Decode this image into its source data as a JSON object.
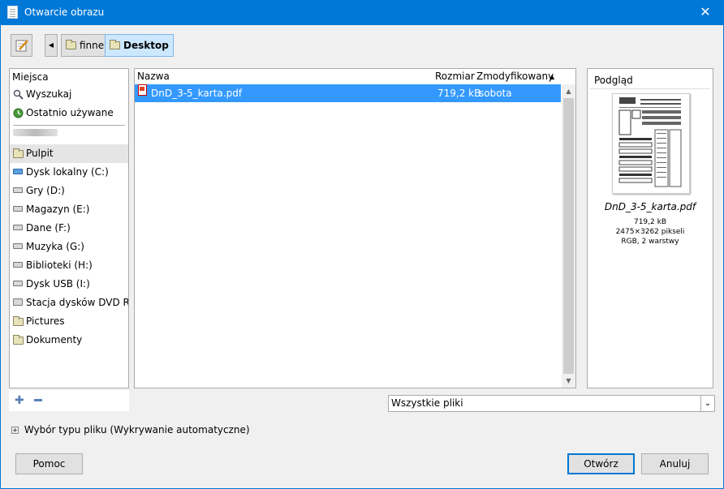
{
  "window": {
    "title": "Otwarcie obrazu",
    "close_glyph": "✕"
  },
  "toolbar": {
    "edit_icon": "pencil-icon",
    "back_glyph": "◀",
    "breadcrumbs": [
      {
        "label": "finne"
      },
      {
        "label": "Desktop"
      }
    ]
  },
  "places": {
    "header": "Miejsca",
    "items": [
      {
        "label": "Wyszukaj",
        "icon": "search-icon"
      },
      {
        "label": "Ostatnio używane",
        "icon": "recent-icon"
      },
      {
        "label": "Pulpit",
        "icon": "folder-icon"
      },
      {
        "label": "Dysk lokalny (C:)",
        "icon": "system-drive-icon"
      },
      {
        "label": "Gry (D:)",
        "icon": "drive-icon"
      },
      {
        "label": "Magazyn (E:)",
        "icon": "drive-icon"
      },
      {
        "label": "Dane (F:)",
        "icon": "drive-icon"
      },
      {
        "label": "Muzyka (G:)",
        "icon": "drive-icon"
      },
      {
        "label": "Biblioteki (H:)",
        "icon": "drive-icon"
      },
      {
        "label": "Dysk USB (I:)",
        "icon": "drive-icon"
      },
      {
        "label": "Stacja dysków DVD R...",
        "icon": "dvd-drive-icon"
      },
      {
        "label": "Pictures",
        "icon": "folder-icon"
      },
      {
        "label": "Dokumenty",
        "icon": "folder-icon"
      }
    ],
    "add_glyph": "✚"
  },
  "files": {
    "columns": {
      "name": "Nazwa",
      "size": "Rozmiar",
      "modified": "Zmodyfikowany",
      "sort_glyph": "▲"
    },
    "rows": [
      {
        "name": "DnD_3-5_karta.pdf",
        "size": "719,2 kB",
        "modified": "sobota"
      }
    ],
    "scroll_up": "▲",
    "scroll_down": "▼"
  },
  "preview": {
    "header": "Podgląd",
    "file_name": "DnD_3-5_karta.pdf",
    "size": "719,2 kB",
    "dimensions": "2475×3262 pikseli",
    "mode": "RGB, 2 warstwy"
  },
  "filter": {
    "value": "Wszystkie pliki",
    "arrow": "⌄"
  },
  "file_type": {
    "toggle_glyph": "+",
    "label": "Wybór typu pliku (Wykrywanie automatyczne)"
  },
  "buttons": {
    "help": "Pomoc",
    "open": "Otwórz",
    "cancel": "Anuluj"
  }
}
